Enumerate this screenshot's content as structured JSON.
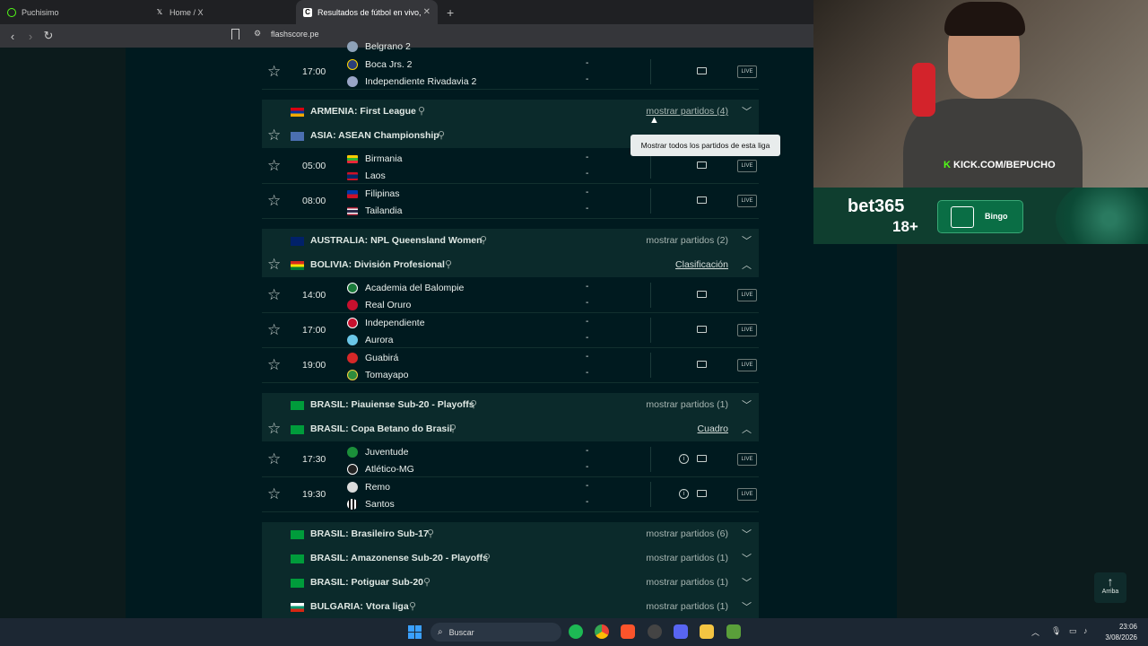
{
  "browser": {
    "tabs": [
      {
        "title": "Puchisimo"
      },
      {
        "title": "Home / X"
      },
      {
        "title": "Resultados de fútbol en vivo, Ma"
      }
    ],
    "new_tab": "+",
    "url": "flashscore.pe"
  },
  "top_partial": {
    "team_above": "Belgrano 2",
    "match": {
      "time": "17:00",
      "home": "Boca Jrs. 2",
      "away": "Independiente Rivadavia 2",
      "home_score": "-",
      "away_score": "-"
    }
  },
  "leagues": [
    {
      "name": "ARMENIA: First League",
      "right": "mostrar partidos (4)"
    },
    {
      "name": "ASIA: ASEAN Championship",
      "matches": [
        {
          "time": "05:00",
          "home": "Birmania",
          "away": "Laos",
          "home_score": "-",
          "away_score": "-"
        },
        {
          "time": "08:00",
          "home": "Filipinas",
          "away": "Tailandia",
          "home_score": "-",
          "away_score": "-"
        }
      ]
    },
    {
      "name": "AUSTRALIA: NPL Queensland Women",
      "right": "mostrar partidos (2)"
    },
    {
      "name": "BOLIVIA: División Profesional",
      "right": "Clasificación",
      "matches": [
        {
          "time": "14:00",
          "home": "Academia del Balompie",
          "away": "Real Oruro",
          "home_score": "-",
          "away_score": "-"
        },
        {
          "time": "17:00",
          "home": "Independiente",
          "away": "Aurora",
          "home_score": "-",
          "away_score": "-"
        },
        {
          "time": "19:00",
          "home": "Guabirá",
          "away": "Tomayapo",
          "home_score": "-",
          "away_score": "-"
        }
      ]
    },
    {
      "name": "BRASIL: Piauiense Sub-20 - Playoffs",
      "right": "mostrar partidos (1)"
    },
    {
      "name": "BRASIL: Copa Betano do Brasil",
      "right": "Cuadro",
      "matches": [
        {
          "time": "17:30",
          "home": "Juventude",
          "away": "Atlético-MG",
          "home_score": "-",
          "away_score": "-"
        },
        {
          "time": "19:30",
          "home": "Remo",
          "away": "Santos",
          "home_score": "-",
          "away_score": "-"
        }
      ]
    },
    {
      "name": "BRASIL: Brasileiro Sub-17",
      "right": "mostrar partidos (6)"
    },
    {
      "name": "BRASIL: Amazonense Sub-20 - Playoffs",
      "right": "mostrar partidos (1)"
    },
    {
      "name": "BRASIL: Potiguar Sub-20",
      "right": "mostrar partidos (1)"
    },
    {
      "name": "BULGARIA: Vtora liga",
      "right": "mostrar partidos (1)"
    }
  ],
  "tooltip": "Mostrar todos los partidos de esta liga",
  "live_label": "LIVE",
  "scroll_top": "Arriba",
  "stream": {
    "channel": "KICK.COM/BEPUCHO"
  },
  "ad": {
    "brand": "bet365",
    "age": "18+",
    "bingo": "Bingo"
  },
  "taskbar": {
    "search": "Buscar",
    "time": "23:06",
    "date": "3/08/2026"
  }
}
